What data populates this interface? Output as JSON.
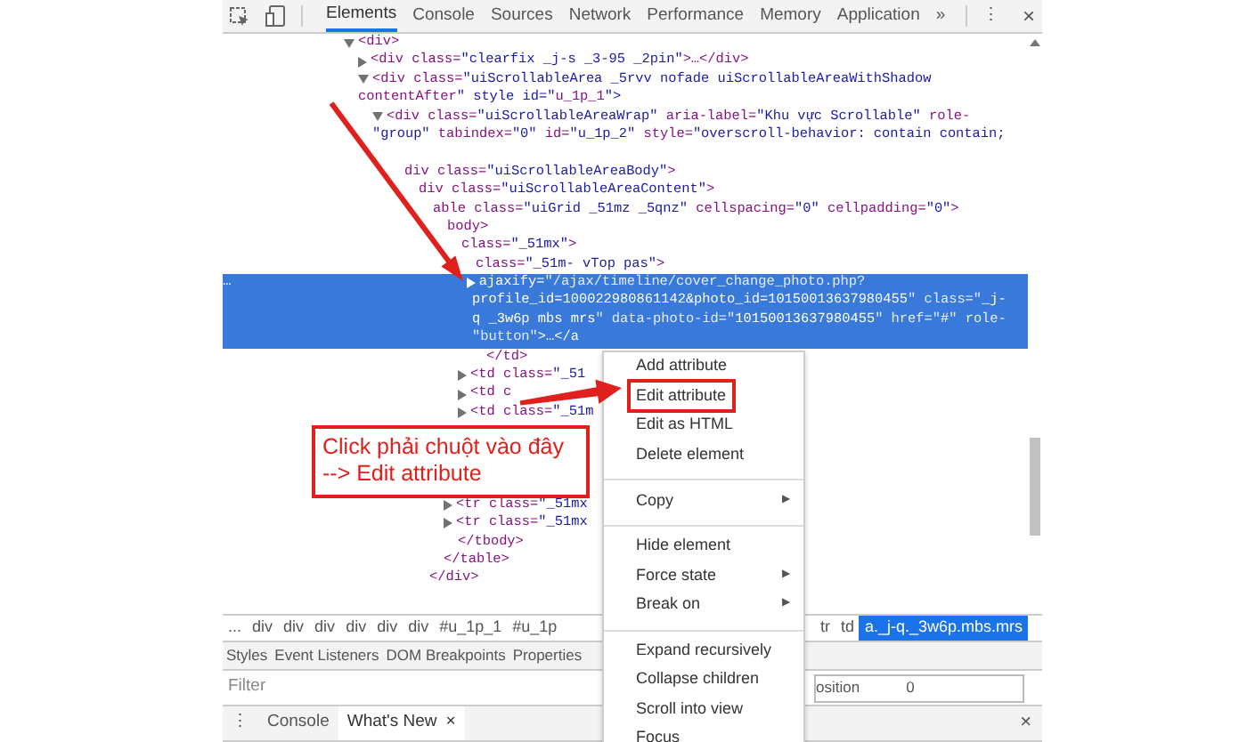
{
  "toolbar": {
    "tabs": [
      {
        "label": "Elements",
        "selected": true
      },
      {
        "label": "Console",
        "selected": false
      },
      {
        "label": "Sources",
        "selected": false
      },
      {
        "label": "Network",
        "selected": false
      },
      {
        "label": "Performance",
        "selected": false
      },
      {
        "label": "Memory",
        "selected": false
      },
      {
        "label": "Application",
        "selected": false
      }
    ],
    "more": "»",
    "menu": "⋮",
    "close": "×"
  },
  "dom_tree": [
    {
      "kind": "expanded",
      "selected": false,
      "lines": [
        "<div>"
      ],
      "children": [
        {
          "kind": "collapsed",
          "selected": false,
          "lines": [
            "<div class=\"clearfix _j-s _3-95 _2pin\">…</div>"
          ]
        },
        {
          "kind": "expanded",
          "selected": false,
          "lines": [
            "<div class=\"uiScrollableArea _5rvv nofade uiScrollableAreaWithShadow",
            "contentAfter\" style id=\"u_1p_1\">"
          ],
          "children": [
            {
              "kind": "expanded",
              "selected": false,
              "lines": [
                "<div class=\"uiScrollableAreaWrap\" aria-label=\"Khu vực Scrollable\" role-",
                "\"group\" tabindex=\"0\" id=\"u_1p_2\" style=\"overscroll-behavior: contain contain;"
              ],
              "children": [
                {
                  "kind": "blank"
                },
                {
                  "kind": "covered",
                  "selected": false,
                  "lines": [
                    "div class=\"uiScrollableAreaBody\">"
                  ],
                  "children": [
                    {
                      "kind": "covered",
                      "selected": false,
                      "lines": [
                        "div class=\"uiScrollableAreaContent\">"
                      ],
                      "children": [
                        {
                          "kind": "covered",
                          "selected": false,
                          "lines": [
                            "able class=\"uiGrid _51mz _5qnz\" cellspacing=\"0\" cellpadding=\"0\">"
                          ],
                          "children": [
                            {
                              "kind": "covered",
                              "selected": false,
                              "lines": [
                                "body>"
                              ],
                              "children": [
                                {
                                  "kind": "covered",
                                  "selected": false,
                                  "lines": [
                                    "class=\"_51mx\">"
                                  ],
                                  "children": [
                                    {
                                      "kind": "covered",
                                      "selected": false,
                                      "lines": [
                                        "class=\"_51m- vTop pas\">"
                                      ],
                                      "children": [
                                        {
                                          "kind": "collapsed",
                                          "selected": true,
                                          "gutter": "…",
                                          "lines": [
                                            "ajaxify=\"/ajax/timeline/cover_change_photo.php?",
                                            "profile_id=100022980861142&photo_id=10150013637980455\" class=\"_j-",
                                            "q _3w6p mbs mrs\" data-photo-id=\"10150013637980455\" href=\"#\" role-",
                                            "\"button\">…</a"
                                          ]
                                        },
                                        {
                                          "kind": "tag",
                                          "selected": false,
                                          "lines": [
                                            "</td>"
                                          ]
                                        }
                                      ]
                                    },
                                    {
                                      "kind": "collapsed",
                                      "selected": false,
                                      "lines": [
                                        "<td class=\"_51"
                                      ]
                                    },
                                    {
                                      "kind": "collapsed",
                                      "selected": false,
                                      "lines": [
                                        "<td c"
                                      ]
                                    },
                                    {
                                      "kind": "collapsed",
                                      "selected": false,
                                      "lines": [
                                        "<td class=\"_51m"
                                      ]
                                    }
                                  ]
                                },
                                {
                                  "kind": "blank"
                                },
                                {
                                  "kind": "blank"
                                },
                                {
                                  "kind": "blank"
                                },
                                {
                                  "kind": "blank"
                                },
                                {
                                  "kind": "collapsed",
                                  "selected": false,
                                  "lines": [
                                    "<tr class=\"_51mx"
                                  ]
                                },
                                {
                                  "kind": "collapsed",
                                  "selected": false,
                                  "lines": [
                                    "<tr class=\"_51mx"
                                  ]
                                },
                                {
                                  "kind": "tag",
                                  "selected": false,
                                  "lines": [
                                    "</tbody>"
                                  ]
                                }
                              ]
                            },
                            {
                              "kind": "tag",
                              "selected": false,
                              "lines": [
                                "</table>"
                              ]
                            }
                          ]
                        },
                        {
                          "kind": "tag",
                          "selected": false,
                          "lines": [
                            "</div>"
                          ]
                        }
                      ]
                    }
                  ]
                }
              ]
            }
          ]
        }
      ]
    }
  ],
  "context_menu": [
    {
      "kind": "item",
      "label": "Add attribute",
      "marked": false
    },
    {
      "kind": "item",
      "label": "Edit attribute",
      "marked": true
    },
    {
      "kind": "item",
      "label": "Edit as HTML",
      "marked": false
    },
    {
      "kind": "item",
      "label": "Delete element",
      "marked": false
    },
    {
      "kind": "separator"
    },
    {
      "kind": "submenu",
      "label": "Copy",
      "arrow": "▶",
      "marked": false
    },
    {
      "kind": "separator"
    },
    {
      "kind": "item",
      "label": "Hide element",
      "marked": false
    },
    {
      "kind": "submenu",
      "label": "Force state",
      "arrow": "▶",
      "marked": false
    },
    {
      "kind": "submenu",
      "label": "Break on",
      "arrow": "▶",
      "marked": false
    },
    {
      "kind": "separator"
    },
    {
      "kind": "item",
      "label": "Expand recursively",
      "marked": false
    },
    {
      "kind": "item",
      "label": "Collapse children",
      "marked": false
    },
    {
      "kind": "item",
      "label": "Scroll into view",
      "marked": false
    },
    {
      "kind": "item",
      "label": "Focus",
      "marked": false
    }
  ],
  "callout": {
    "lines": [
      "Click phải chuột vào đây",
      "--> Edit attribute"
    ]
  },
  "breadcrumbs": {
    "left": [
      {
        "label": "...",
        "selected": false
      },
      {
        "label": "div",
        "selected": false
      },
      {
        "label": "div",
        "selected": false
      },
      {
        "label": "div",
        "selected": false
      },
      {
        "label": "div",
        "selected": false
      },
      {
        "label": "div",
        "selected": false
      },
      {
        "label": "div",
        "selected": false
      },
      {
        "label": "#u_1p_1",
        "selected": false
      },
      {
        "label": "#u_1p",
        "selected": false
      }
    ],
    "right": [
      {
        "label": "tr",
        "selected": false
      },
      {
        "label": "td",
        "selected": false
      },
      {
        "label": "a._j-q._3w6p.mbs.mrs",
        "selected": true
      }
    ]
  },
  "styles_tabs": [
    "Styles",
    "Event Listeners",
    "DOM Breakpoints",
    "Properties"
  ],
  "filter": {
    "placeholder": "Filter"
  },
  "box_model": {
    "label": "osition",
    "value": "0"
  },
  "drawer": {
    "menu": "⋮",
    "tabs": [
      {
        "label": "Console",
        "selected": false
      },
      {
        "label": "What's New",
        "selected": true,
        "close": "×"
      }
    ],
    "close": "×"
  }
}
